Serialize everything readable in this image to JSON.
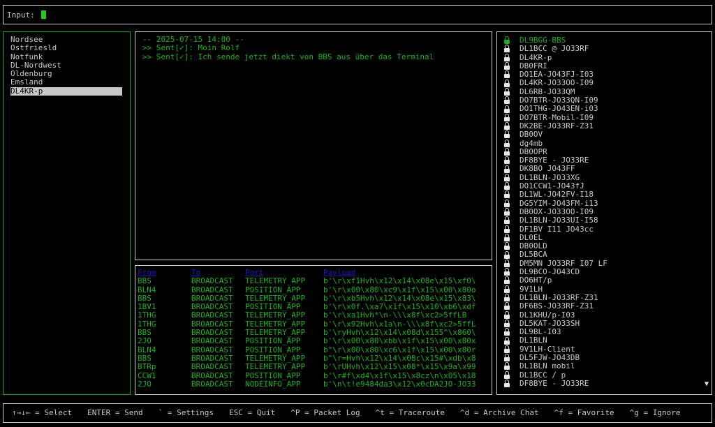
{
  "input": {
    "label": "Input:",
    "value": ""
  },
  "channels": {
    "items": [
      "Nordsee",
      "Ostfriesld",
      "Notfunk",
      "DL-Nordwest",
      "Oldenburg",
      "Emsland",
      "DL4KR-p"
    ],
    "selected_index": 6
  },
  "chat": {
    "lines": [
      "-- 2025-07-15 14:00 --",
      ">> Sent[✓]: Moin Rolf",
      ">> Sent[✓]: Ich sende jetzt diekt von BBS aus über das Terminal"
    ]
  },
  "packets": {
    "headers": {
      "from": "From",
      "to": "To",
      "port": "Port",
      "payload": "Payload"
    },
    "rows": [
      [
        "BBS",
        "BROADCAST",
        "TELEMETRY_APP",
        "b'\\r\\xf1Hvh\\x12\\x14\\x08e\\x15\\xf0\\"
      ],
      [
        "BLN4",
        "BROADCAST",
        "POSITION_APP",
        "b'\\r\\x00\\x80\\xc9\\x1f\\x15\\x00\\x80o"
      ],
      [
        "BBS",
        "BROADCAST",
        "TELEMETRY_APP",
        "b'\\r\\xb5Hvh\\x12\\x14\\x08e\\x15\\x83\\"
      ],
      [
        "1BV1",
        "BROADCAST",
        "POSITION_APP",
        "b'\\r\\x0f.\\xa7\\x1f\\x15\\x10\\xb6\\xdf"
      ],
      [
        "1THG",
        "BROADCAST",
        "TELEMETRY_APP",
        "b'\\r\\xa1Hvh*\\n-\\\\\\x8f\\xc2>5ffLB"
      ],
      [
        "1THG",
        "BROADCAST",
        "TELEMETRY_APP",
        "b'\\r\\x92Hvh\\x1a\\n-\\\\\\x8f\\xc2>5ffL"
      ],
      [
        "BBS",
        "BROADCAST",
        "TELEMETRY_APP",
        "b'\\ryHvh\\x12\\x14\\x08d\\x155^\\x860\\"
      ],
      [
        "2JO",
        "BROADCAST",
        "POSITION_APP",
        "b'\\r\\x00\\x80\\xbb\\x1f\\x15\\x00\\x80x"
      ],
      [
        "BLN4",
        "BROADCAST",
        "POSITION_APP",
        "b\"\\r\\x00\\x80\\xc6\\x1f\\x15\\x00\\x80r"
      ],
      [
        "BBS",
        "BROADCAST",
        "TELEMETRY_APP",
        "b\"\\r=Hvh\\x12\\x14\\x08c\\x15#\\xdb\\x8"
      ],
      [
        "BTRp",
        "BROADCAST",
        "TELEMETRY_APP",
        "b'\\rUHvh\\x12\\x15\\x08*\\x15\\x9a\\x99"
      ],
      [
        "CCW1",
        "BROADCAST",
        "POSITION_APP",
        "b'\\r#f\\xd4\\x1f\\x15\\x8cz\\n\\x05\\x18"
      ],
      [
        "2JO",
        "BROADCAST",
        "NODEINFO_APP",
        "b'\\n\\t!e9484da3\\x12\\x0cDA2JO-JO33"
      ]
    ]
  },
  "nodes": {
    "items": [
      "DL9BGG-BBS",
      "DL1BCC @ JO33RF",
      "DL4KR-p",
      "DB0FRI",
      "DO1EA-JO43FJ-I03",
      "DL4KR-JO33OO-I09",
      "DL6RB-JO33QM",
      "DO7BTR-JO33QN-I09",
      "DO1THG-JO43EN-i03",
      "DO7BTR-Mobil-I09",
      "DK2BE-JO33RF-Z31",
      "DB0OV",
      "dg4mb",
      "DB0OPR",
      "DF8BYE - JO33RE",
      "DK8BO JO43FF",
      "DL1BLN-JO33XG",
      "DO1CCW1-JO43fJ",
      "DL1WL-JO42FV-I18",
      "DG5YIM-JO43FM-i13",
      "DB0OX-JO33OO-I09",
      "DL1BLN-JO33UI-I58",
      "DF1BV I11 JO43cc",
      "DL0EL",
      "DB0OLD",
      "DL5BCA",
      "DM5MN JO33RF I07 LF",
      "DL9BCO-JO43CD",
      "DO6HT/p",
      "9V1LH",
      "DL1BLN-JO33RF-Z31",
      "DF6BS-JO33RF-Z31",
      "DL1KHU/p-I03",
      "DL5KAT-JO33SH",
      "DL9BL-I03",
      "DL1BLN",
      "9V1LH-Client",
      "DL5FJW-JO43DB",
      "DL1BLN mobil",
      "DL1BCC / p",
      "DF8BYE - JO33RE"
    ],
    "scroll_indicator": "▼"
  },
  "footer": {
    "keys": [
      "↑→↓← = Select",
      "ENTER = Send",
      "` = Settings",
      "ESC = Quit",
      "^P = Packet Log",
      "^t = Traceroute",
      "^d = Archive Chat",
      "^f = Favorite",
      "^g = Ignore"
    ]
  },
  "colors": {
    "accent_green": "#19b319",
    "cursor_green": "#17d017",
    "header_blue": "#1a1ac0",
    "text": "#c8c8c8",
    "background": "#000000"
  }
}
